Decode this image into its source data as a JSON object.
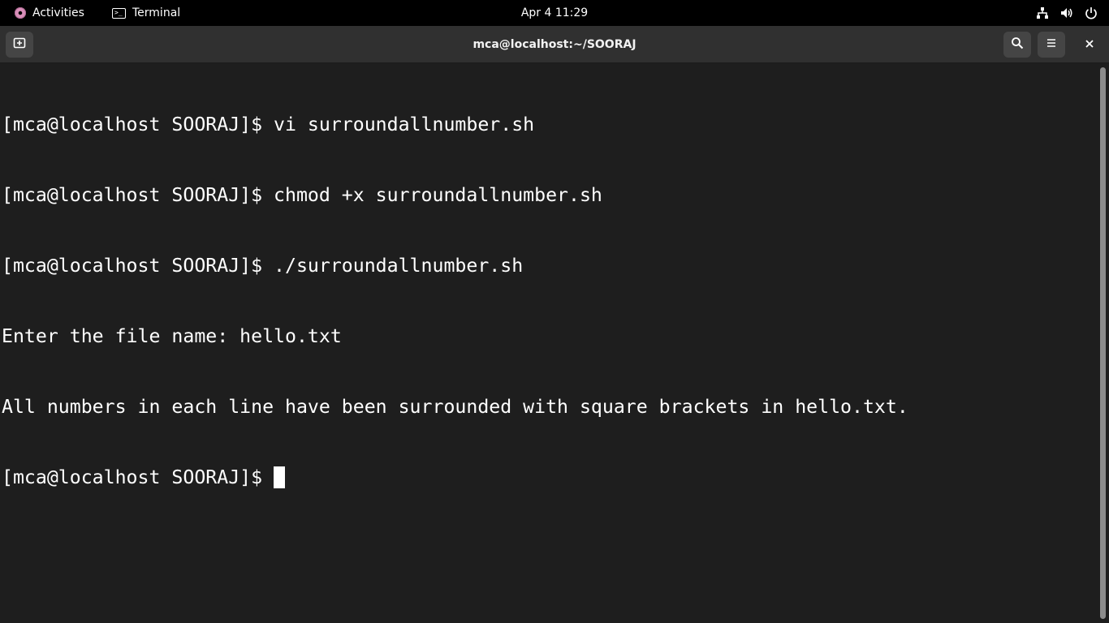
{
  "topbar": {
    "activities_label": "Activities",
    "app_label": "Terminal",
    "clock": "Apr 4  11:29",
    "icons": [
      "network-icon",
      "volume-icon",
      "power-icon"
    ]
  },
  "window": {
    "title": "mca@localhost:~/SOORAJ",
    "buttons": [
      "new-tab-icon",
      "search-icon",
      "hamburger-menu-icon",
      "close-icon"
    ]
  },
  "terminal": {
    "lines": [
      "[mca@localhost SOORAJ]$ vi surroundallnumber.sh",
      "[mca@localhost SOORAJ]$ chmod +x surroundallnumber.sh",
      "[mca@localhost SOORAJ]$ ./surroundallnumber.sh",
      "Enter the file name: hello.txt",
      "All numbers in each line have been surrounded with square brackets in hello.txt."
    ],
    "prompt": "[mca@localhost SOORAJ]$ "
  },
  "colors": {
    "terminal_bg": "#1e1e1e",
    "headerbar_bg": "#303030",
    "topbar_bg": "#000000",
    "text": "#ffffff"
  }
}
